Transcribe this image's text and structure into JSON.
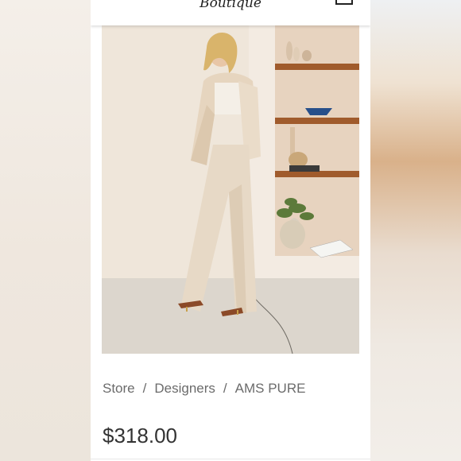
{
  "header": {
    "logo_text": "Boutique",
    "bag_icon": "shopping-bag-icon"
  },
  "hero": {
    "image": "product-photo"
  },
  "breadcrumb": {
    "items": [
      {
        "label": "Store"
      },
      {
        "label": "Designers"
      },
      {
        "label": "AMS PURE"
      }
    ],
    "separator": "/"
  },
  "product": {
    "price": "$318.00"
  }
}
